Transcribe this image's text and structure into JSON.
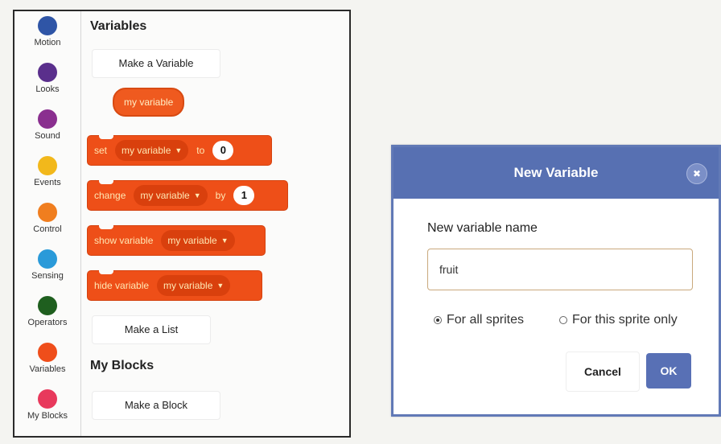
{
  "categories": [
    {
      "label": "Motion",
      "color": "#2f55a6",
      "icon": "motion-dot"
    },
    {
      "label": "Looks",
      "color": "#5a2f8c",
      "icon": "looks-dot"
    },
    {
      "label": "Sound",
      "color": "#8a2f8f",
      "icon": "sound-dot"
    },
    {
      "label": "Events",
      "color": "#f2b81b",
      "icon": "events-dot"
    },
    {
      "label": "Control",
      "color": "#f07e1f",
      "icon": "control-dot"
    },
    {
      "label": "Sensing",
      "color": "#2a9ad9",
      "icon": "sensing-dot"
    },
    {
      "label": "Operators",
      "color": "#1f5f1f",
      "icon": "operators-dot"
    },
    {
      "label": "Variables",
      "color": "#ef4e1b",
      "icon": "variables-dot"
    },
    {
      "label": "My Blocks",
      "color": "#e8395c",
      "icon": "myblocks-dot"
    }
  ],
  "variables_section": {
    "title": "Variables",
    "make_variable": "Make a Variable",
    "reporter": "my variable",
    "blocks": {
      "set": {
        "word": "set",
        "var": "my variable",
        "to": "to",
        "value": "0"
      },
      "change": {
        "word": "change",
        "var": "my variable",
        "by": "by",
        "value": "1"
      },
      "show": {
        "word": "show variable",
        "var": "my variable"
      },
      "hide": {
        "word": "hide variable",
        "var": "my variable"
      }
    },
    "make_list": "Make a List"
  },
  "my_blocks_section": {
    "title": "My Blocks",
    "make_block": "Make a Block"
  },
  "dialog": {
    "title": "New Variable",
    "close_glyph": "✖",
    "label": "New variable name",
    "input_value": "fruit",
    "radio_all": "For all sprites",
    "radio_this": "For this sprite only",
    "selected": "For all sprites",
    "cancel": "Cancel",
    "ok": "OK",
    "header_color": "#5770b2"
  }
}
